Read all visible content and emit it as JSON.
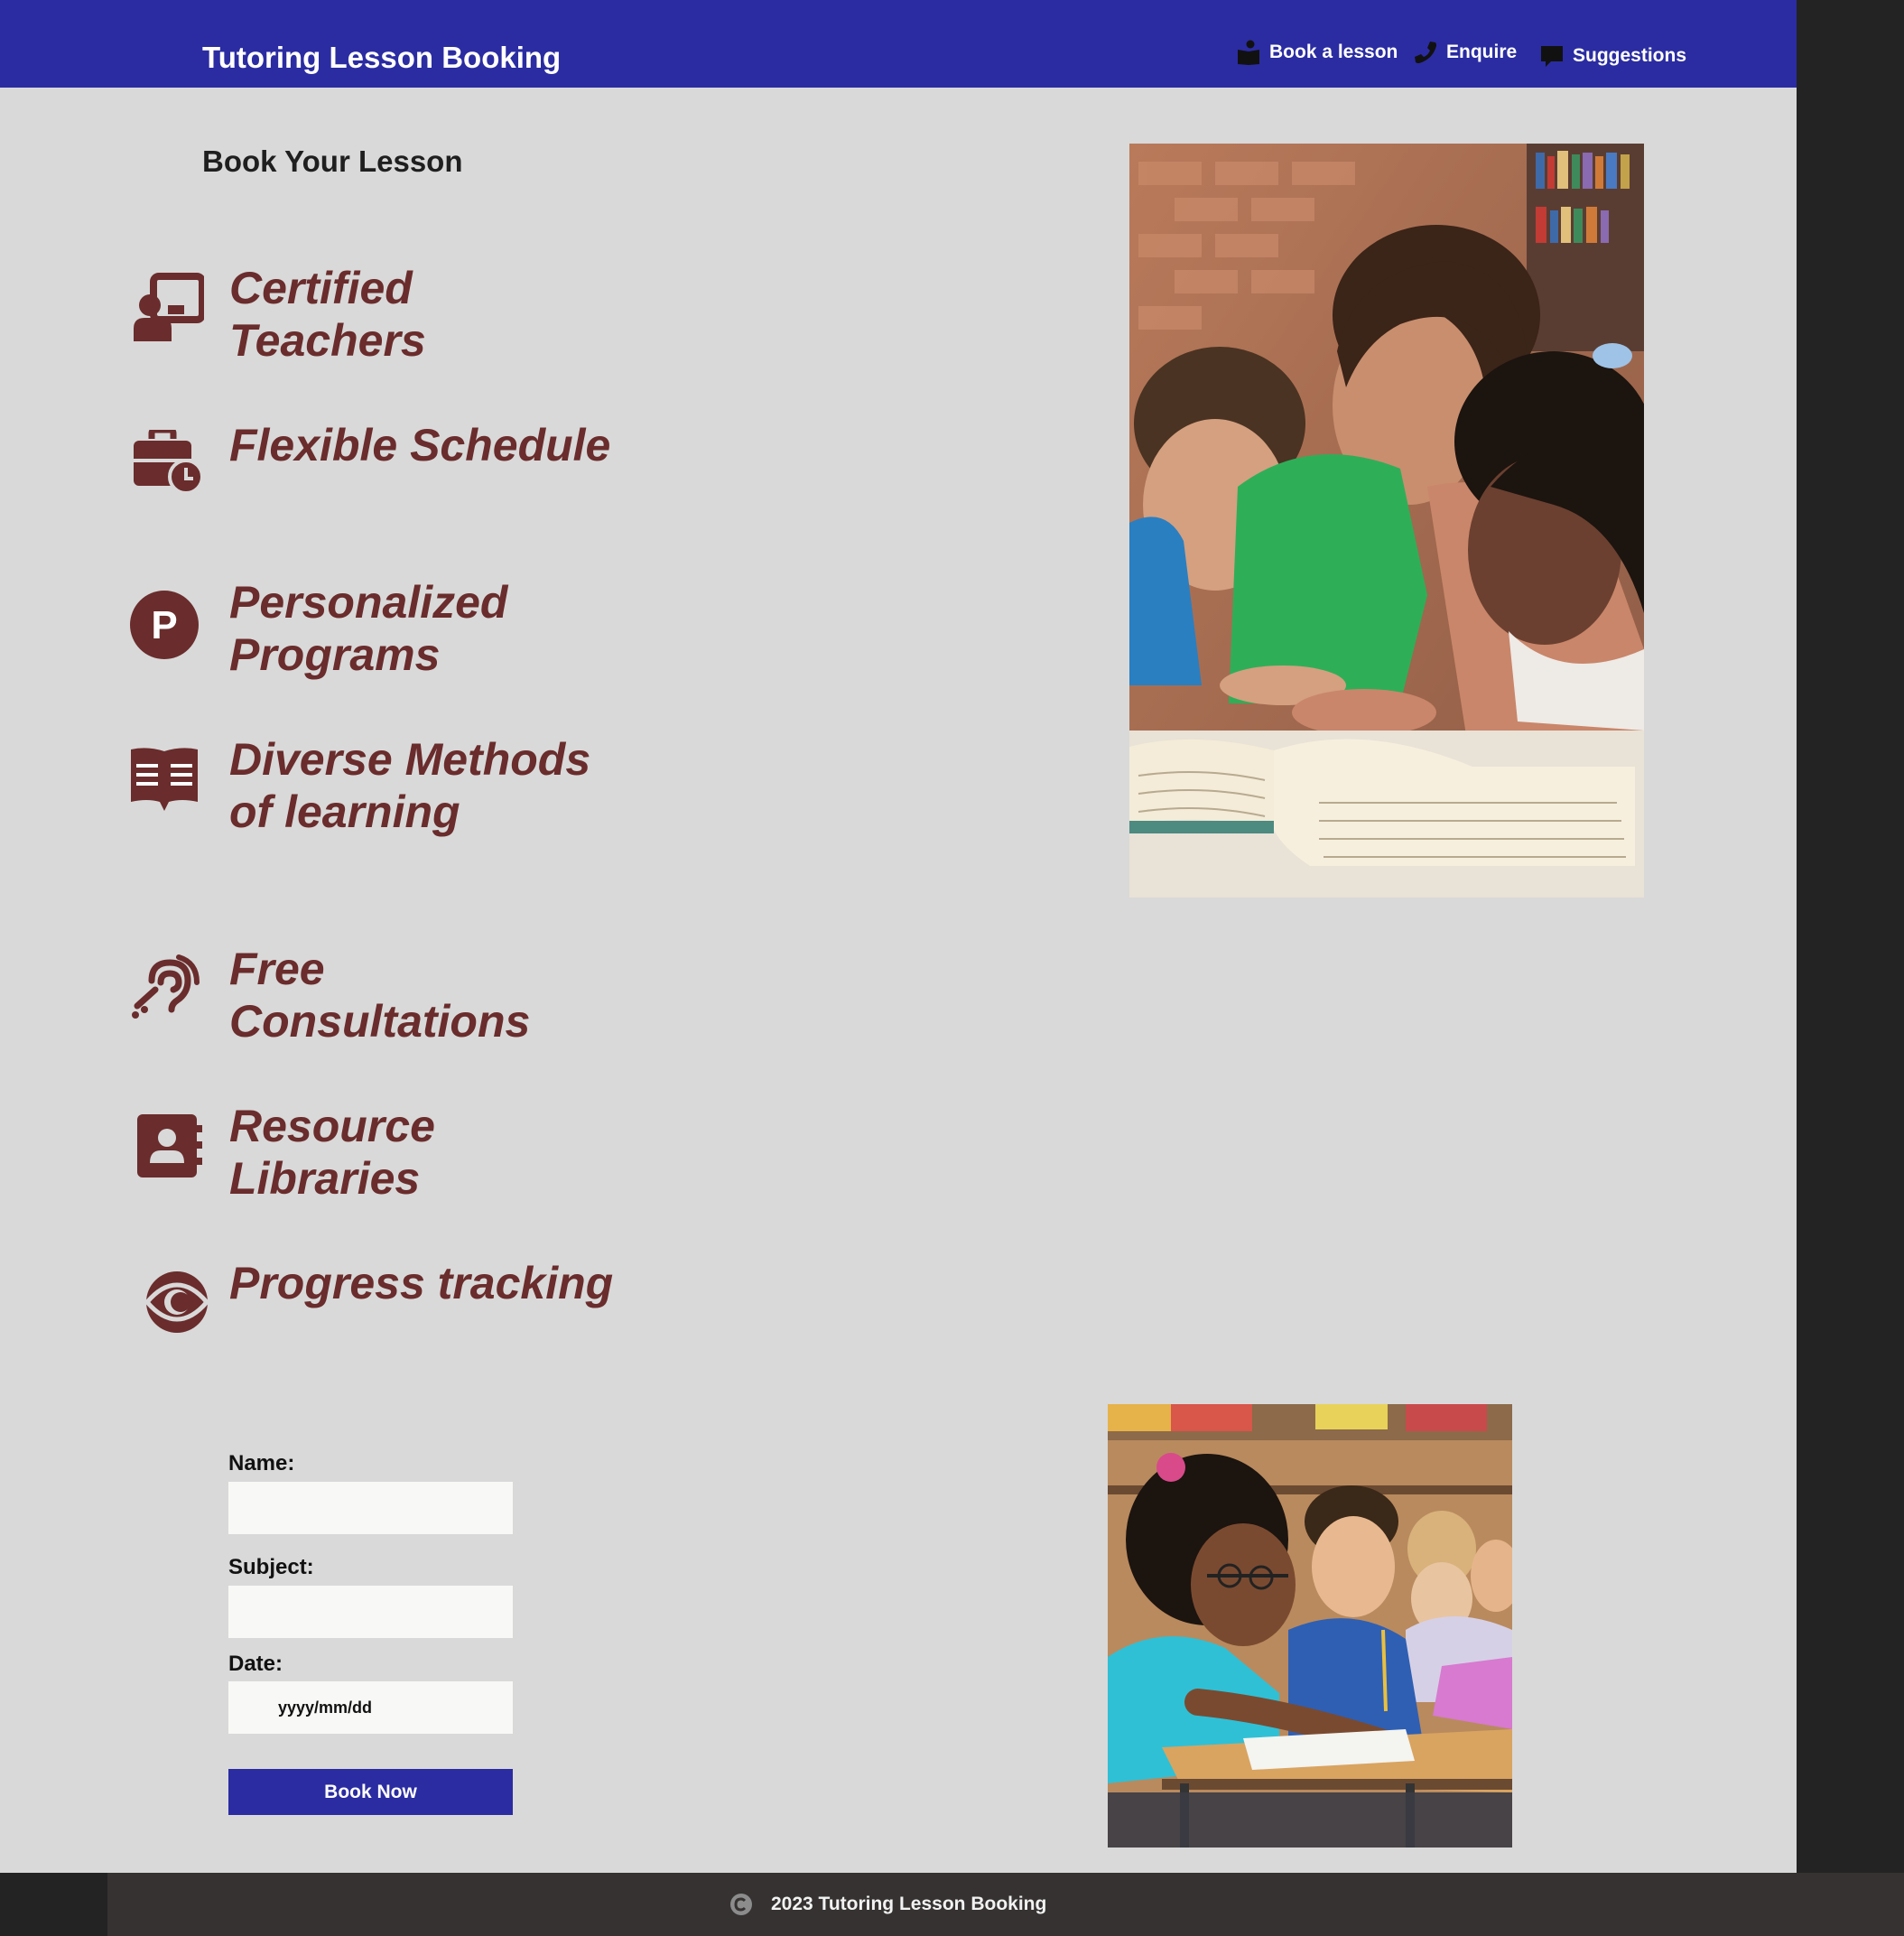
{
  "header": {
    "brand": "Tutoring Lesson Booking",
    "nav": [
      {
        "label": "Book a lesson",
        "icon": "book-reader-icon"
      },
      {
        "label": "Enquire",
        "icon": "phone-icon"
      },
      {
        "label": "Suggestions",
        "icon": "comment-icon"
      }
    ]
  },
  "main": {
    "title": "Book Your Lesson",
    "features": [
      {
        "label": "Certified Teachers",
        "icon": "chalkboard-teacher-icon"
      },
      {
        "label": "Flexible Schedule",
        "icon": "business-time-icon"
      },
      {
        "label": "Personalized Programs",
        "icon": "parking-circle-icon"
      },
      {
        "label": "Diverse Methods of learning",
        "icon": "book-open-reader-icon"
      },
      {
        "label": "Free Consultations",
        "icon": "assistive-listening-icon"
      },
      {
        "label": "Resource Libraries",
        "icon": "address-book-icon"
      },
      {
        "label": "Progress tracking",
        "icon": "eye-circle-icon"
      }
    ]
  },
  "form": {
    "name_label": "Name:",
    "subject_label": "Subject:",
    "date_label": "Date:",
    "date_placeholder": "yyyy/mm/dd",
    "submit_label": "Book Now"
  },
  "footer": {
    "text": "2023 Tutoring Lesson Booking",
    "icon": "copyright-icon"
  },
  "colors": {
    "header_bg": "#2b2ca1",
    "page_bg": "#d9d9d9",
    "feature_color": "#6a2c2c",
    "footer_bg": "#353231",
    "button_bg": "#2b2ca1"
  }
}
